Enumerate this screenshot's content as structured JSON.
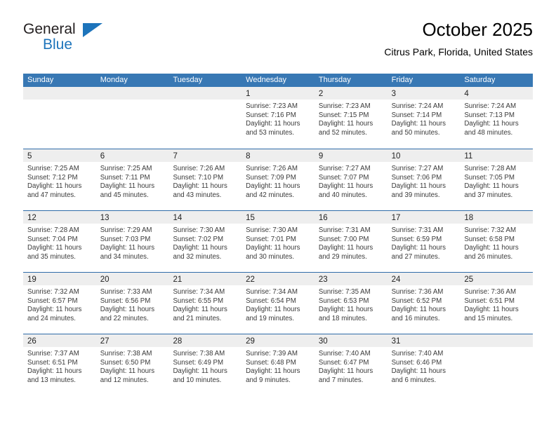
{
  "brand": {
    "name_part1": "General",
    "name_part2": "Blue",
    "logo_colors": {
      "text": "#231f20",
      "accent": "#1d74bb"
    }
  },
  "header": {
    "title": "October 2025",
    "subtitle": "Citrus Park, Florida, United States"
  },
  "theme": {
    "header_blue": "#3878b4",
    "divider_blue": "#2e6ba8",
    "day_band_gray": "#eeeeee"
  },
  "weekdays": [
    "Sunday",
    "Monday",
    "Tuesday",
    "Wednesday",
    "Thursday",
    "Friday",
    "Saturday"
  ],
  "weeks": [
    [
      {
        "day": "",
        "empty": true
      },
      {
        "day": "",
        "empty": true
      },
      {
        "day": "",
        "empty": true
      },
      {
        "day": "1",
        "sunrise": "Sunrise: 7:23 AM",
        "sunset": "Sunset: 7:16 PM",
        "daylight1": "Daylight: 11 hours",
        "daylight2": "and 53 minutes."
      },
      {
        "day": "2",
        "sunrise": "Sunrise: 7:23 AM",
        "sunset": "Sunset: 7:15 PM",
        "daylight1": "Daylight: 11 hours",
        "daylight2": "and 52 minutes."
      },
      {
        "day": "3",
        "sunrise": "Sunrise: 7:24 AM",
        "sunset": "Sunset: 7:14 PM",
        "daylight1": "Daylight: 11 hours",
        "daylight2": "and 50 minutes."
      },
      {
        "day": "4",
        "sunrise": "Sunrise: 7:24 AM",
        "sunset": "Sunset: 7:13 PM",
        "daylight1": "Daylight: 11 hours",
        "daylight2": "and 48 minutes."
      }
    ],
    [
      {
        "day": "5",
        "sunrise": "Sunrise: 7:25 AM",
        "sunset": "Sunset: 7:12 PM",
        "daylight1": "Daylight: 11 hours",
        "daylight2": "and 47 minutes."
      },
      {
        "day": "6",
        "sunrise": "Sunrise: 7:25 AM",
        "sunset": "Sunset: 7:11 PM",
        "daylight1": "Daylight: 11 hours",
        "daylight2": "and 45 minutes."
      },
      {
        "day": "7",
        "sunrise": "Sunrise: 7:26 AM",
        "sunset": "Sunset: 7:10 PM",
        "daylight1": "Daylight: 11 hours",
        "daylight2": "and 43 minutes."
      },
      {
        "day": "8",
        "sunrise": "Sunrise: 7:26 AM",
        "sunset": "Sunset: 7:09 PM",
        "daylight1": "Daylight: 11 hours",
        "daylight2": "and 42 minutes."
      },
      {
        "day": "9",
        "sunrise": "Sunrise: 7:27 AM",
        "sunset": "Sunset: 7:07 PM",
        "daylight1": "Daylight: 11 hours",
        "daylight2": "and 40 minutes."
      },
      {
        "day": "10",
        "sunrise": "Sunrise: 7:27 AM",
        "sunset": "Sunset: 7:06 PM",
        "daylight1": "Daylight: 11 hours",
        "daylight2": "and 39 minutes."
      },
      {
        "day": "11",
        "sunrise": "Sunrise: 7:28 AM",
        "sunset": "Sunset: 7:05 PM",
        "daylight1": "Daylight: 11 hours",
        "daylight2": "and 37 minutes."
      }
    ],
    [
      {
        "day": "12",
        "sunrise": "Sunrise: 7:28 AM",
        "sunset": "Sunset: 7:04 PM",
        "daylight1": "Daylight: 11 hours",
        "daylight2": "and 35 minutes."
      },
      {
        "day": "13",
        "sunrise": "Sunrise: 7:29 AM",
        "sunset": "Sunset: 7:03 PM",
        "daylight1": "Daylight: 11 hours",
        "daylight2": "and 34 minutes."
      },
      {
        "day": "14",
        "sunrise": "Sunrise: 7:30 AM",
        "sunset": "Sunset: 7:02 PM",
        "daylight1": "Daylight: 11 hours",
        "daylight2": "and 32 minutes."
      },
      {
        "day": "15",
        "sunrise": "Sunrise: 7:30 AM",
        "sunset": "Sunset: 7:01 PM",
        "daylight1": "Daylight: 11 hours",
        "daylight2": "and 30 minutes."
      },
      {
        "day": "16",
        "sunrise": "Sunrise: 7:31 AM",
        "sunset": "Sunset: 7:00 PM",
        "daylight1": "Daylight: 11 hours",
        "daylight2": "and 29 minutes."
      },
      {
        "day": "17",
        "sunrise": "Sunrise: 7:31 AM",
        "sunset": "Sunset: 6:59 PM",
        "daylight1": "Daylight: 11 hours",
        "daylight2": "and 27 minutes."
      },
      {
        "day": "18",
        "sunrise": "Sunrise: 7:32 AM",
        "sunset": "Sunset: 6:58 PM",
        "daylight1": "Daylight: 11 hours",
        "daylight2": "and 26 minutes."
      }
    ],
    [
      {
        "day": "19",
        "sunrise": "Sunrise: 7:32 AM",
        "sunset": "Sunset: 6:57 PM",
        "daylight1": "Daylight: 11 hours",
        "daylight2": "and 24 minutes."
      },
      {
        "day": "20",
        "sunrise": "Sunrise: 7:33 AM",
        "sunset": "Sunset: 6:56 PM",
        "daylight1": "Daylight: 11 hours",
        "daylight2": "and 22 minutes."
      },
      {
        "day": "21",
        "sunrise": "Sunrise: 7:34 AM",
        "sunset": "Sunset: 6:55 PM",
        "daylight1": "Daylight: 11 hours",
        "daylight2": "and 21 minutes."
      },
      {
        "day": "22",
        "sunrise": "Sunrise: 7:34 AM",
        "sunset": "Sunset: 6:54 PM",
        "daylight1": "Daylight: 11 hours",
        "daylight2": "and 19 minutes."
      },
      {
        "day": "23",
        "sunrise": "Sunrise: 7:35 AM",
        "sunset": "Sunset: 6:53 PM",
        "daylight1": "Daylight: 11 hours",
        "daylight2": "and 18 minutes."
      },
      {
        "day": "24",
        "sunrise": "Sunrise: 7:36 AM",
        "sunset": "Sunset: 6:52 PM",
        "daylight1": "Daylight: 11 hours",
        "daylight2": "and 16 minutes."
      },
      {
        "day": "25",
        "sunrise": "Sunrise: 7:36 AM",
        "sunset": "Sunset: 6:51 PM",
        "daylight1": "Daylight: 11 hours",
        "daylight2": "and 15 minutes."
      }
    ],
    [
      {
        "day": "26",
        "sunrise": "Sunrise: 7:37 AM",
        "sunset": "Sunset: 6:51 PM",
        "daylight1": "Daylight: 11 hours",
        "daylight2": "and 13 minutes."
      },
      {
        "day": "27",
        "sunrise": "Sunrise: 7:38 AM",
        "sunset": "Sunset: 6:50 PM",
        "daylight1": "Daylight: 11 hours",
        "daylight2": "and 12 minutes."
      },
      {
        "day": "28",
        "sunrise": "Sunrise: 7:38 AM",
        "sunset": "Sunset: 6:49 PM",
        "daylight1": "Daylight: 11 hours",
        "daylight2": "and 10 minutes."
      },
      {
        "day": "29",
        "sunrise": "Sunrise: 7:39 AM",
        "sunset": "Sunset: 6:48 PM",
        "daylight1": "Daylight: 11 hours",
        "daylight2": "and 9 minutes."
      },
      {
        "day": "30",
        "sunrise": "Sunrise: 7:40 AM",
        "sunset": "Sunset: 6:47 PM",
        "daylight1": "Daylight: 11 hours",
        "daylight2": "and 7 minutes."
      },
      {
        "day": "31",
        "sunrise": "Sunrise: 7:40 AM",
        "sunset": "Sunset: 6:46 PM",
        "daylight1": "Daylight: 11 hours",
        "daylight2": "and 6 minutes."
      },
      {
        "day": "",
        "empty": true
      }
    ]
  ]
}
